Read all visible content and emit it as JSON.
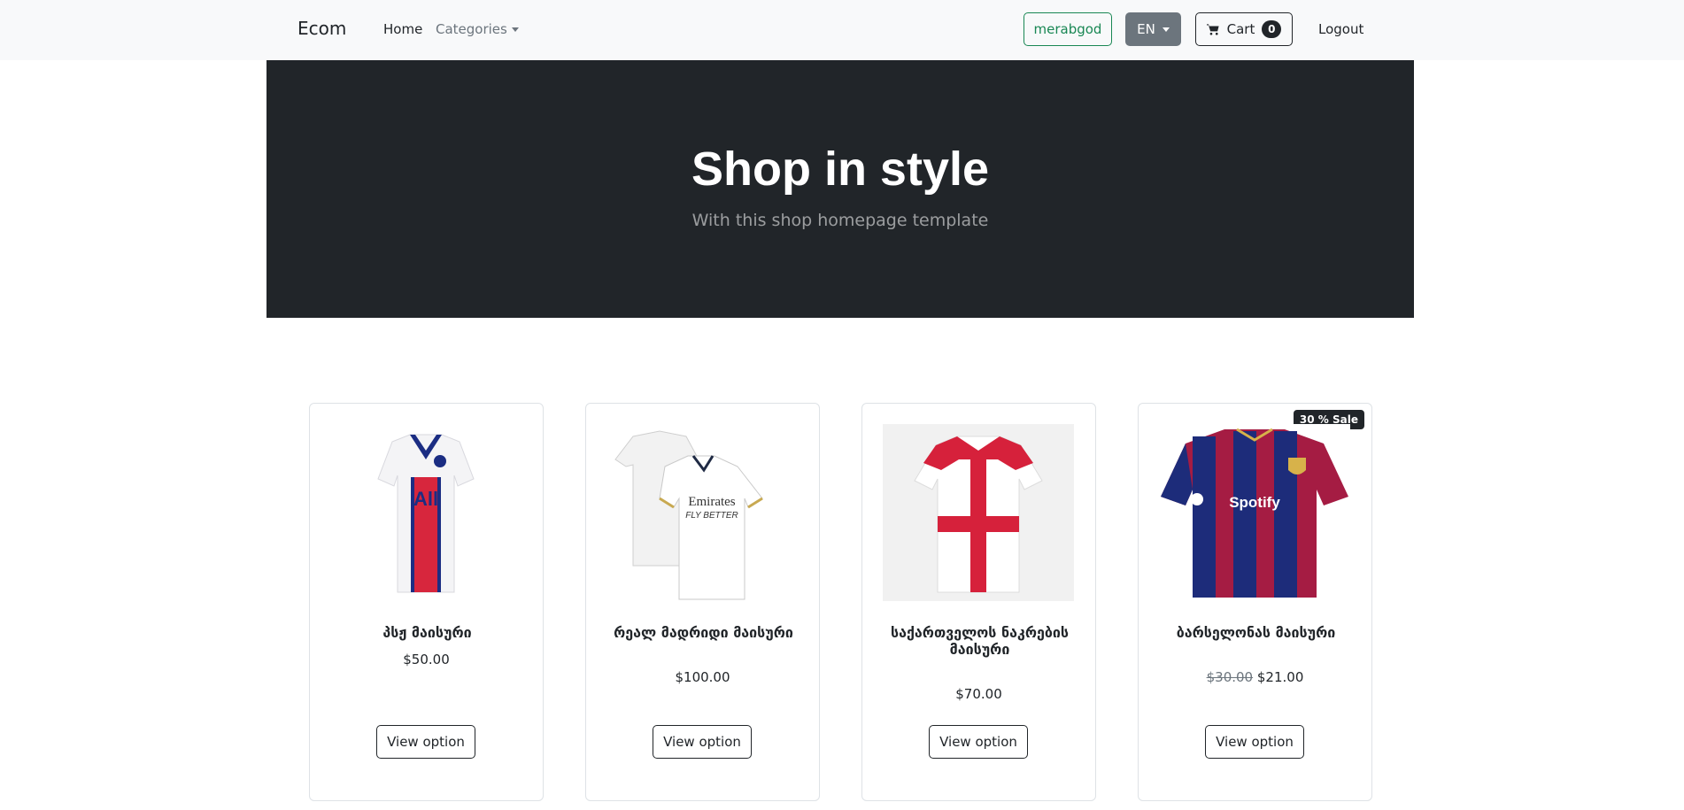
{
  "navbar": {
    "brand": "Ecom",
    "home": "Home",
    "categories": "Categories",
    "user": "merabgod",
    "language": "EN",
    "cart_label": "Cart",
    "cart_count": "0",
    "logout": "Logout"
  },
  "hero": {
    "title": "Shop in style",
    "subtitle": "With this shop homepage template"
  },
  "products": [
    {
      "name": "პსჟ მაისური",
      "price": "$50.00",
      "button": "View option",
      "image_icon": "psg-jersey-image"
    },
    {
      "name": "რეალ მადრიდი მაისური",
      "price": "$100.00",
      "button": "View option",
      "image_icon": "real-madrid-jersey-image"
    },
    {
      "name": "საქართველოს ნაკრების მაისური",
      "price": "$70.00",
      "button": "View option",
      "image_icon": "georgia-jersey-image"
    },
    {
      "name": "ბარსელონას მაისური",
      "old_price": "$30.00",
      "price": "$21.00",
      "sale_badge": "30 % Sale",
      "button": "View option",
      "image_icon": "barcelona-jersey-image"
    }
  ],
  "colors": {
    "dark": "#212529",
    "success": "#198754",
    "secondary": "#6c757d",
    "navbar_bg": "#f8f9fa"
  }
}
